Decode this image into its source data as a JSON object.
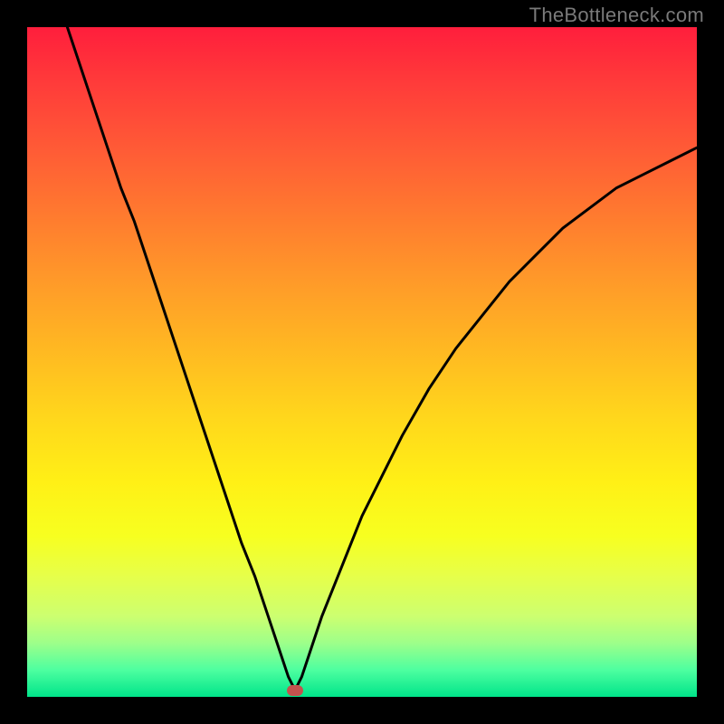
{
  "watermark": "TheBottleneck.com",
  "colors": {
    "frame": "#000000",
    "gradient_top": "#ff1e3c",
    "gradient_bottom": "#00e48a",
    "curve": "#000000",
    "marker": "#c4524e"
  },
  "chart_data": {
    "type": "line",
    "title": "",
    "xlabel": "",
    "ylabel": "",
    "xlim": [
      0,
      100
    ],
    "ylim": [
      0,
      100
    ],
    "legend": false,
    "grid": false,
    "annotations": [
      {
        "type": "marker",
        "x": 40,
        "y": 1,
        "label": "minimum"
      }
    ],
    "series": [
      {
        "name": "left-branch",
        "x": [
          6,
          8,
          10,
          12,
          14,
          16,
          18,
          20,
          22,
          24,
          26,
          28,
          30,
          32,
          34,
          35,
          36,
          37,
          38,
          39,
          40
        ],
        "y": [
          100,
          94,
          88,
          82,
          76,
          71,
          65,
          59,
          53,
          47,
          41,
          35,
          29,
          23,
          18,
          15,
          12,
          9,
          6,
          3,
          1
        ]
      },
      {
        "name": "right-branch",
        "x": [
          40,
          41,
          42,
          43,
          44,
          46,
          48,
          50,
          53,
          56,
          60,
          64,
          68,
          72,
          76,
          80,
          84,
          88,
          92,
          96,
          100
        ],
        "y": [
          1,
          3,
          6,
          9,
          12,
          17,
          22,
          27,
          33,
          39,
          46,
          52,
          57,
          62,
          66,
          70,
          73,
          76,
          78,
          80,
          82
        ]
      }
    ]
  }
}
